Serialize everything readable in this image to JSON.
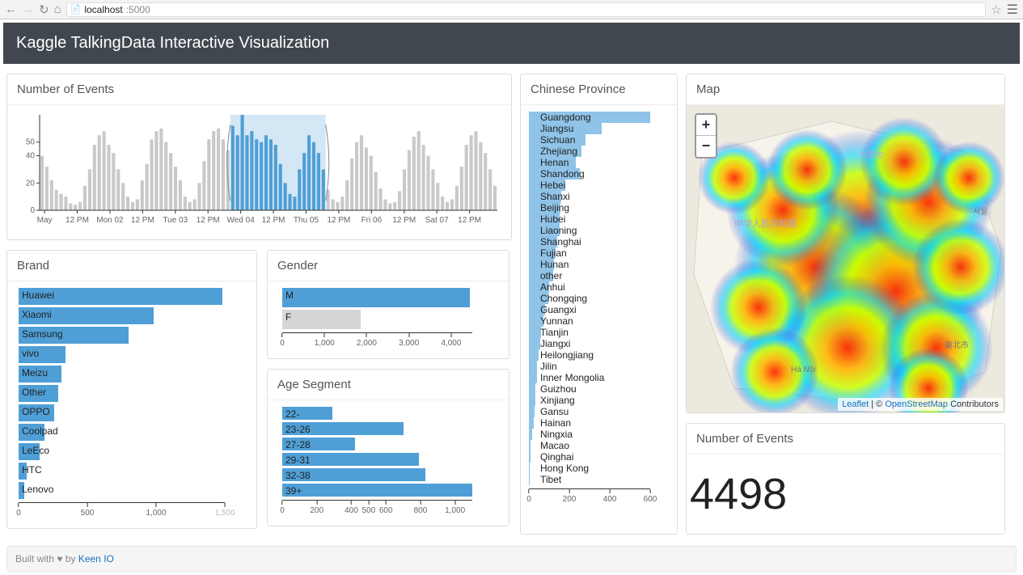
{
  "browser": {
    "url_host": "localhost",
    "url_port": ":5000"
  },
  "header": {
    "title": "Kaggle TalkingData Interactive Visualization"
  },
  "panels": {
    "events_ts": {
      "title": "Number of Events"
    },
    "brand": {
      "title": "Brand"
    },
    "gender": {
      "title": "Gender"
    },
    "age": {
      "title": "Age Segment"
    },
    "province": {
      "title": "Chinese Province"
    },
    "map": {
      "title": "Map"
    },
    "count": {
      "title": "Number of Events",
      "value": "4498"
    }
  },
  "map": {
    "zoom_in": "+",
    "zoom_out": "−",
    "attr_prefix": "",
    "attr_leaflet": "Leaflet",
    "attr_sep": " | © ",
    "attr_osm": "OpenStreetMap",
    "attr_suffix": " Contributors"
  },
  "footer": {
    "text": "Built with ♥ by ",
    "link": "Keen IO"
  },
  "chart_data": [
    {
      "id": "events_ts",
      "type": "bar",
      "title": "Number of Events",
      "ylabel": "",
      "ylim": [
        0,
        70
      ],
      "y_ticks": [
        0,
        20,
        40,
        50
      ],
      "x_ticks": [
        "May",
        "12 PM",
        "Mon 02",
        "12 PM",
        "Tue 03",
        "12 PM",
        "Wed 04",
        "12 PM",
        "Thu 05",
        "12 PM",
        "Fri 06",
        "12 PM",
        "Sat 07",
        "12 PM"
      ],
      "brush": {
        "start_index": 40,
        "end_index": 60
      },
      "values": [
        40,
        32,
        22,
        15,
        12,
        10,
        5,
        4,
        6,
        18,
        30,
        48,
        55,
        58,
        48,
        42,
        30,
        20,
        10,
        6,
        8,
        22,
        34,
        52,
        58,
        60,
        50,
        42,
        32,
        22,
        10,
        6,
        8,
        20,
        36,
        52,
        58,
        60,
        52,
        44,
        62,
        55,
        70,
        55,
        58,
        52,
        50,
        55,
        52,
        48,
        34,
        20,
        12,
        10,
        30,
        42,
        55,
        50,
        42,
        30,
        15,
        8,
        6,
        10,
        22,
        38,
        50,
        55,
        46,
        40,
        28,
        16,
        8,
        5,
        6,
        14,
        30,
        44,
        54,
        58,
        48,
        40,
        30,
        20,
        10,
        6,
        8,
        18,
        32,
        48,
        55,
        58,
        50,
        42,
        30,
        18
      ]
    },
    {
      "id": "brand",
      "type": "bar_horizontal",
      "title": "Brand",
      "xlim": [
        0,
        1500
      ],
      "x_ticks": [
        0,
        500,
        1000,
        1500
      ],
      "categories": [
        "Huawei",
        "Xiaomi",
        "Samsung",
        "vivo",
        "Meizu",
        "Other",
        "OPPO",
        "Coolpad",
        "LeEco",
        "HTC",
        "Lenovo"
      ],
      "values": [
        1480,
        980,
        800,
        340,
        310,
        290,
        260,
        190,
        150,
        60,
        40
      ]
    },
    {
      "id": "gender",
      "type": "bar_horizontal",
      "title": "Gender",
      "xlim": [
        0,
        4500
      ],
      "x_ticks": [
        0,
        1000,
        2000,
        3000,
        4000
      ],
      "categories": [
        "M",
        "F"
      ],
      "values": [
        4450,
        1850
      ],
      "deselected": [
        "F"
      ]
    },
    {
      "id": "age",
      "type": "bar_horizontal",
      "title": "Age Segment",
      "xlim": [
        0,
        1100
      ],
      "x_ticks": [
        0,
        200,
        400,
        500,
        600,
        800,
        1000
      ],
      "categories": [
        "22-",
        "23-26",
        "27-28",
        "29-31",
        "32-38",
        "39+"
      ],
      "values": [
        290,
        700,
        420,
        790,
        830,
        1100
      ]
    },
    {
      "id": "province",
      "type": "bar_horizontal",
      "title": "Chinese Province",
      "xlim": [
        0,
        600
      ],
      "x_ticks": [
        0,
        200,
        400,
        600
      ],
      "categories": [
        "Guangdong",
        "Jiangsu",
        "Sichuan",
        "Zhejiang",
        "Henan",
        "Shandong",
        "Hebei",
        "Shanxi",
        "Beijing",
        "Hubei",
        "Liaoning",
        "Shanghai",
        "Fujian",
        "Hunan",
        "other",
        "Anhui",
        "Chongqing",
        "Guangxi",
        "Yunnan",
        "Tianjin",
        "Jiangxi",
        "Heilongjiang",
        "Jilin",
        "Inner Mongolia",
        "Guizhou",
        "Xinjiang",
        "Gansu",
        "Hainan",
        "Ningxia",
        "Macao",
        "Qinghai",
        "Hong Kong",
        "Tibet"
      ],
      "values": [
        600,
        360,
        280,
        260,
        230,
        250,
        180,
        160,
        155,
        150,
        150,
        140,
        130,
        125,
        120,
        100,
        95,
        80,
        70,
        60,
        55,
        48,
        40,
        38,
        32,
        30,
        28,
        22,
        15,
        8,
        6,
        5,
        3
      ]
    }
  ]
}
